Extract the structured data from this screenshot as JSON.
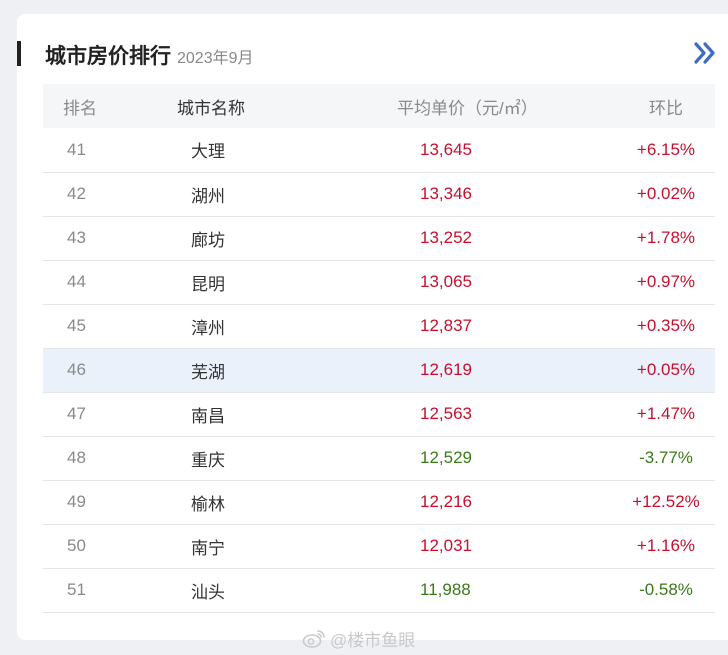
{
  "header": {
    "title": "城市房价排行",
    "subtitle": "2023年9月"
  },
  "colors": {
    "up": "#c8102e",
    "down": "#3a7a1a",
    "accent": "#3d6cc7",
    "highlight_row": "#eaf1fb"
  },
  "table": {
    "columns": [
      "排名",
      "城市名称",
      "平均单价（元/㎡）",
      "环比"
    ],
    "rows": [
      {
        "rank": "41",
        "city": "大理",
        "price": "13,645",
        "change": "+6.15%",
        "trend": "up"
      },
      {
        "rank": "42",
        "city": "湖州",
        "price": "13,346",
        "change": "+0.02%",
        "trend": "up"
      },
      {
        "rank": "43",
        "city": "廊坊",
        "price": "13,252",
        "change": "+1.78%",
        "trend": "up"
      },
      {
        "rank": "44",
        "city": "昆明",
        "price": "13,065",
        "change": "+0.97%",
        "trend": "up"
      },
      {
        "rank": "45",
        "city": "漳州",
        "price": "12,837",
        "change": "+0.35%",
        "trend": "up"
      },
      {
        "rank": "46",
        "city": "芜湖",
        "price": "12,619",
        "change": "+0.05%",
        "trend": "up",
        "highlight": true
      },
      {
        "rank": "47",
        "city": "南昌",
        "price": "12,563",
        "change": "+1.47%",
        "trend": "up"
      },
      {
        "rank": "48",
        "city": "重庆",
        "price": "12,529",
        "change": "-3.77%",
        "trend": "down"
      },
      {
        "rank": "49",
        "city": "榆林",
        "price": "12,216",
        "change": "+12.52%",
        "trend": "up"
      },
      {
        "rank": "50",
        "city": "南宁",
        "price": "12,031",
        "change": "+1.16%",
        "trend": "up"
      },
      {
        "rank": "51",
        "city": "汕头",
        "price": "11,988",
        "change": "-0.58%",
        "trend": "down"
      }
    ]
  },
  "watermark": {
    "text": "@楼市鱼眼",
    "icon": "weibo-icon"
  },
  "more_icon": "double-chevron-right-icon"
}
